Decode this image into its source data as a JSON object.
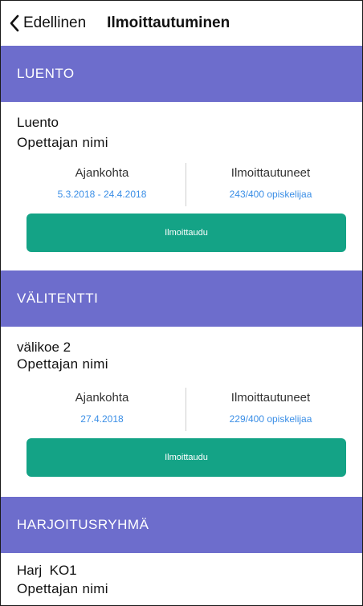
{
  "header": {
    "back_label": "Edellinen",
    "title": "Ilmoittautuminen"
  },
  "colors": {
    "section_header": "#6d6dcc",
    "button": "#14a386",
    "link_value": "#3a8ee6"
  },
  "sections": [
    {
      "title": "LUENTO",
      "course": {
        "name": "Luento",
        "teacher": "Opettajan nimi",
        "time_label": "Ajankohta",
        "time_value": "5.3.2018 - 24.4.2018",
        "enrolled_label": "Ilmoittautuneet",
        "enrolled_value": "243/400 opiskelijaa",
        "button_label": "Ilmoittaudu"
      }
    },
    {
      "title": "VÄLITENTTI",
      "course": {
        "name": "välikoe 2",
        "teacher": "Opettajan nimi",
        "time_label": "Ajankohta",
        "time_value": "27.4.2018",
        "enrolled_label": "Ilmoittautuneet",
        "enrolled_value": "229/400 opiskelijaa",
        "button_label": "Ilmoittaudu"
      }
    },
    {
      "title": "HARJOITUSRYHMÄ",
      "course": {
        "name": "Harj  KO1",
        "teacher": "Opettajan nimi"
      }
    }
  ]
}
